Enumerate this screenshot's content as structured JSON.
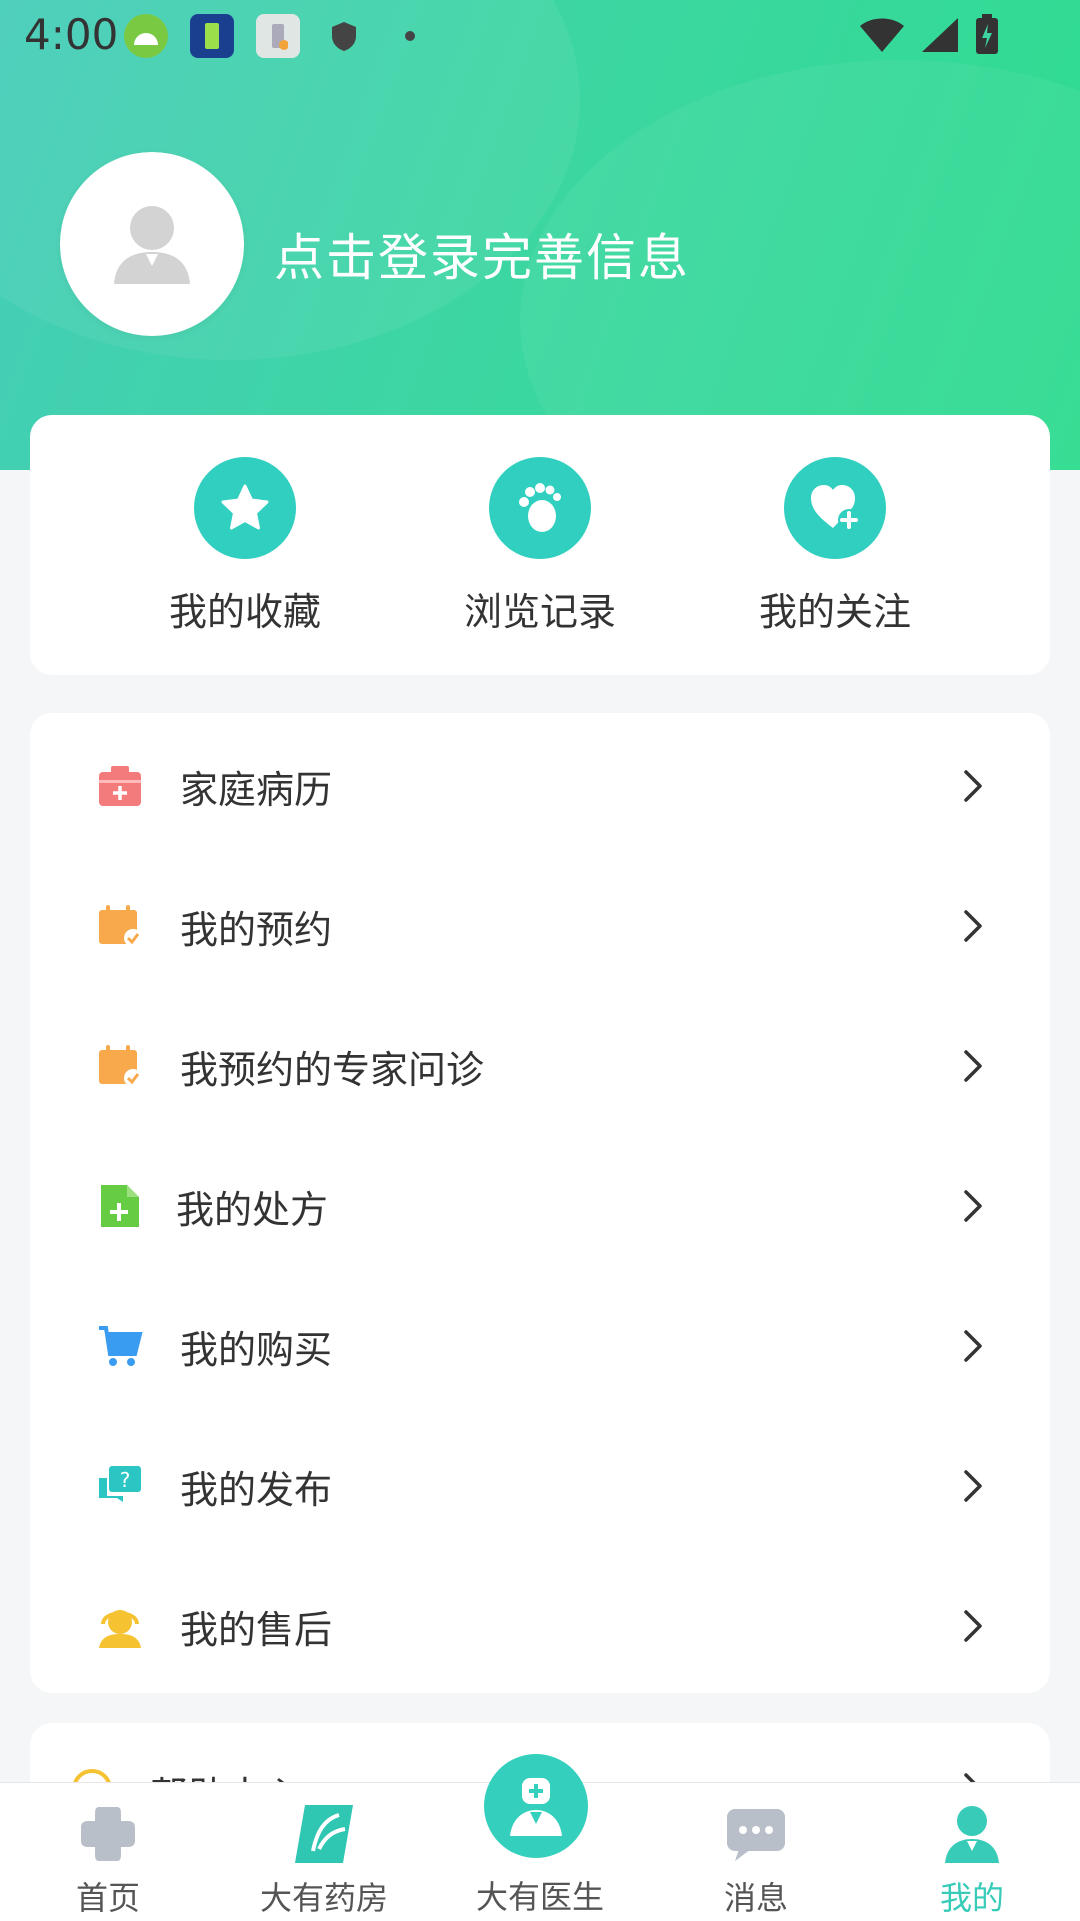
{
  "status_bar": {
    "time": "4:00"
  },
  "profile": {
    "login_prompt": "点击登录完善信息"
  },
  "quick_actions": [
    {
      "label": "我的收藏",
      "icon": "star-icon"
    },
    {
      "label": "浏览记录",
      "icon": "footprint-icon"
    },
    {
      "label": "我的关注",
      "icon": "heart-plus-icon"
    }
  ],
  "menu": [
    {
      "label": "家庭病历",
      "icon": "medical-record-icon",
      "color": "#f26a6a"
    },
    {
      "label": "我的预约",
      "icon": "appointment-calendar-icon",
      "color": "#f7a94c"
    },
    {
      "label": "我预约的专家问诊",
      "icon": "expert-calendar-icon",
      "color": "#f7a94c"
    },
    {
      "label": "我的处方",
      "icon": "prescription-icon",
      "color": "#66cc44"
    },
    {
      "label": "我的购买",
      "icon": "shopping-cart-icon",
      "color": "#3a9cf0"
    },
    {
      "label": "我的发布",
      "icon": "question-chat-icon",
      "color": "#2bc6c4"
    },
    {
      "label": "我的售后",
      "icon": "customer-service-icon",
      "color": "#f5c232"
    }
  ],
  "help": {
    "label": "帮助中心"
  },
  "tabbar": {
    "home": "首页",
    "pharmacy": "大有药房",
    "doctor": "大有医生",
    "messages": "消息",
    "mine": "我的"
  },
  "colors": {
    "accent": "#34cfbd",
    "header_gradient_start": "#45cdb9",
    "header_gradient_end": "#2edc8f"
  }
}
